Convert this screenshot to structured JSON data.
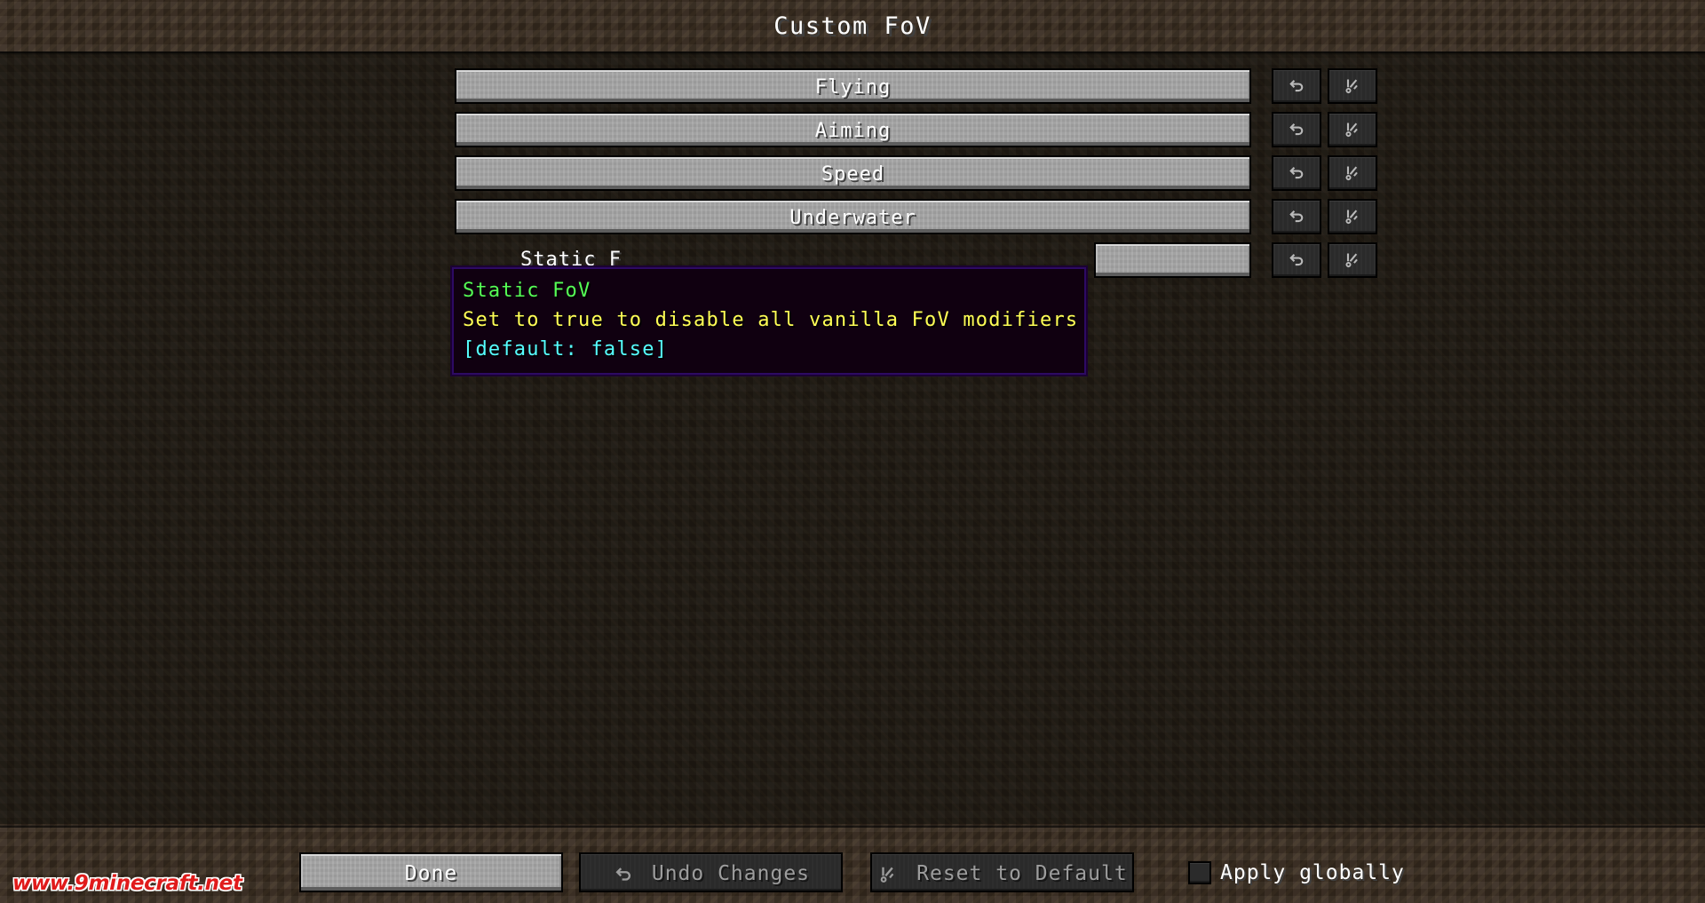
{
  "window": {
    "title": "Custom FoV"
  },
  "rows": [
    {
      "label": "",
      "button_label": "Flying",
      "undo_icon": "undo-arrow-icon",
      "reset_icon": "reset-sparkle-icon",
      "has_value_widget": false
    },
    {
      "label": "",
      "button_label": "Aiming",
      "undo_icon": "undo-arrow-icon",
      "reset_icon": "reset-sparkle-icon",
      "has_value_widget": false
    },
    {
      "label": "",
      "button_label": "Speed",
      "undo_icon": "undo-arrow-icon",
      "reset_icon": "reset-sparkle-icon",
      "has_value_widget": false
    },
    {
      "label": "",
      "button_label": "Underwater",
      "undo_icon": "undo-arrow-icon",
      "reset_icon": "reset-sparkle-icon",
      "has_value_widget": false
    },
    {
      "label": "Static F",
      "button_label": "",
      "undo_icon": "undo-arrow-icon",
      "reset_icon": "reset-sparkle-icon",
      "has_value_widget": true
    }
  ],
  "tooltip": {
    "title": "Static FoV",
    "description": "Set to true to disable all vanilla FoV modifiers",
    "default_text": "[default: false]",
    "title_color": "#55ff55",
    "description_color": "#ffff55",
    "default_color": "#55ffff",
    "background_color": "#100010",
    "border_color": "#2d0a63"
  },
  "bottom_bar": {
    "done_label": "Done",
    "undo_label": "Undo Changes",
    "undo_icon": "undo-arrow-icon",
    "reset_label": "Reset to Default",
    "reset_icon": "reset-sparkle-icon",
    "apply_globally_label": "Apply globally",
    "apply_globally_checked": false
  },
  "watermark": {
    "text": "www.9minecraft.net",
    "color": "#e01b1b"
  }
}
